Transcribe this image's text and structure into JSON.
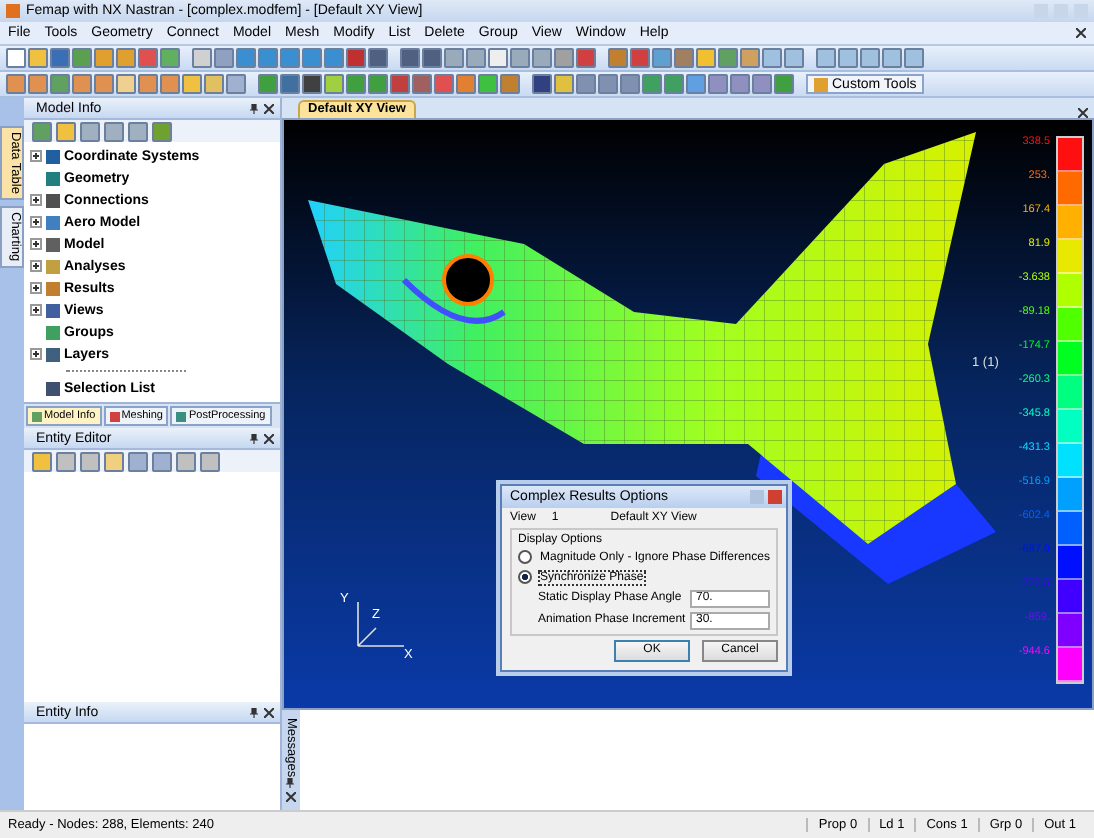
{
  "window": {
    "title": "Femap with NX Nastran - [complex.modfem] - [Default XY View]"
  },
  "menu": [
    "File",
    "Tools",
    "Geometry",
    "Connect",
    "Model",
    "Mesh",
    "Modify",
    "List",
    "Delete",
    "Group",
    "View",
    "Window",
    "Help"
  ],
  "custom_tools": "Custom Tools",
  "side_tabs": [
    {
      "label": "Data Table",
      "selected": true
    },
    {
      "label": "Charting",
      "selected": false
    }
  ],
  "model_info": {
    "title": "Model Info",
    "tree": [
      {
        "label": "Coordinate Systems",
        "expandable": true
      },
      {
        "label": "Geometry",
        "expandable": false
      },
      {
        "label": "Connections",
        "expandable": true
      },
      {
        "label": "Aero Model",
        "expandable": true
      },
      {
        "label": "Model",
        "expandable": true
      },
      {
        "label": "Analyses",
        "expandable": true
      },
      {
        "label": "Results",
        "expandable": true
      },
      {
        "label": "Views",
        "expandable": true
      },
      {
        "label": "Groups",
        "expandable": false
      },
      {
        "label": "Layers",
        "expandable": true
      }
    ],
    "selection_list": "Selection List"
  },
  "panel_tabs": [
    {
      "label": "Model Info",
      "selected": true
    },
    {
      "label": "Meshing",
      "selected": false
    },
    {
      "label": "PostProcessing",
      "selected": false
    }
  ],
  "entity_editor": {
    "title": "Entity Editor"
  },
  "entity_info": {
    "title": "Entity Info"
  },
  "view_tab": "Default XY View",
  "viewport": {
    "node_label": "1 (1)",
    "axes": [
      "Y",
      "Z",
      "X"
    ],
    "legend": [
      {
        "value": "338.5",
        "color": "#ff1010"
      },
      {
        "value": "253.",
        "color": "#ff6a00"
      },
      {
        "value": "167.4",
        "color": "#ffb000"
      },
      {
        "value": "81.9",
        "color": "#e8e800"
      },
      {
        "value": "-3.638",
        "color": "#b0ff00"
      },
      {
        "value": "-89.18",
        "color": "#50ff00"
      },
      {
        "value": "-174.7",
        "color": "#00ff20"
      },
      {
        "value": "-260.3",
        "color": "#00ff80"
      },
      {
        "value": "-345.8",
        "color": "#00ffc0"
      },
      {
        "value": "-431.3",
        "color": "#00e0ff"
      },
      {
        "value": "-516.9",
        "color": "#00a0ff"
      },
      {
        "value": "-602.4",
        "color": "#0060ff"
      },
      {
        "value": "-687.9",
        "color": "#0010ff"
      },
      {
        "value": "-773.5",
        "color": "#4000ff"
      },
      {
        "value": "-859.",
        "color": "#8000ff"
      },
      {
        "value": "-944.6",
        "color": "#ff00ff"
      }
    ]
  },
  "dialog": {
    "title": "Complex Results Options",
    "view_label": "View",
    "view_number": "1",
    "view_name": "Default XY View",
    "group": "Display Options",
    "options": [
      {
        "label": "Magnitude Only - Ignore Phase Differences",
        "selected": false
      },
      {
        "label": "Synchronize Phase",
        "selected": true
      }
    ],
    "fields": [
      {
        "label": "Static Display Phase Angle",
        "value": "70."
      },
      {
        "label": "Animation Phase Increment",
        "value": "30."
      }
    ],
    "buttons": [
      "OK",
      "Cancel"
    ]
  },
  "messages": {
    "title": "Messages"
  },
  "status_bar": {
    "text": "Ready - Nodes: 288, Elements: 240",
    "cells": [
      "Prop 0",
      "Ld 1",
      "Cons 1",
      "Grp 0",
      "Out 1"
    ]
  }
}
